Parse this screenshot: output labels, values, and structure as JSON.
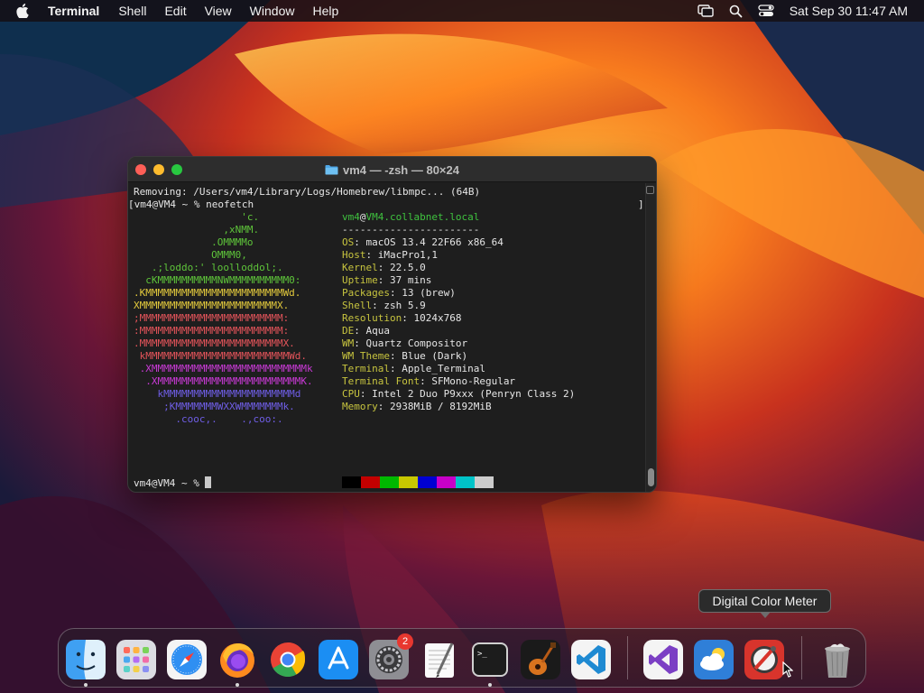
{
  "menubar": {
    "app_name": "Terminal",
    "menus": [
      "Shell",
      "Edit",
      "View",
      "Window",
      "Help"
    ],
    "clock": "Sat Sep 30  11:47 AM",
    "status_icons": [
      "screen-mirroring-icon",
      "spotlight-search-icon",
      "control-center-icon"
    ]
  },
  "terminal": {
    "title": "vm4 — -zsh — 80×24",
    "removing_line": "Removing: /Users/vm4/Library/Logs/Homebrew/libmpc... (64B)",
    "prompt_command": "[vm4@VM4 ~ % neofetch",
    "prompt_bracket_end": "]",
    "final_prompt": "vm4@VM4 ~ % ",
    "logo_lines": [
      "                  'c.",
      "               ,xNMM.",
      "             .OMMMMo",
      "             OMMM0,",
      "   .;loddo:' loolloddol;.",
      "  cKMMMMMMMMMMNWMMMMMMMMMM0:",
      ".KMMMMMMMMMMMMMMMMMMMMMMMWd.",
      "XMMMMMMMMMMMMMMMMMMMMMMMX.",
      ";MMMMMMMMMMMMMMMMMMMMMMMM:",
      ":MMMMMMMMMMMMMMMMMMMMMMMM:",
      ".MMMMMMMMMMMMMMMMMMMMMMMMX.",
      " kMMMMMMMMMMMMMMMMMMMMMMMMWd.",
      " .XMMMMMMMMMMMMMMMMMMMMMMMMMMk",
      "  .XMMMMMMMMMMMMMMMMMMMMMMMMK.",
      "    kMMMMMMMMMMMMMMMMMMMMMMd",
      "     ;KMMMMMMMWXXWMMMMMMMk.",
      "       .cooc,.    .,coo:."
    ],
    "userhost_user": "vm4",
    "userhost_at": "@",
    "userhost_host": "VM4.collabnet.local",
    "separator": "-----------------------",
    "info": [
      {
        "key": "OS",
        "value": "macOS 13.4 22F66 x86_64"
      },
      {
        "key": "Host",
        "value": "iMacPro1,1"
      },
      {
        "key": "Kernel",
        "value": "22.5.0"
      },
      {
        "key": "Uptime",
        "value": "37 mins"
      },
      {
        "key": "Packages",
        "value": "13 (brew)"
      },
      {
        "key": "Shell",
        "value": "zsh 5.9"
      },
      {
        "key": "Resolution",
        "value": "1024x768"
      },
      {
        "key": "DE",
        "value": "Aqua"
      },
      {
        "key": "WM",
        "value": "Quartz Compositor"
      },
      {
        "key": "WM Theme",
        "value": "Blue (Dark)"
      },
      {
        "key": "Terminal",
        "value": "Apple_Terminal"
      },
      {
        "key": "Terminal Font",
        "value": "SFMono-Regular"
      },
      {
        "key": "CPU",
        "value": "Intel 2 Duo P9xxx (Penryn Class 2)"
      },
      {
        "key": "Memory",
        "value": "2938MiB / 8192MiB"
      }
    ],
    "colors": {
      "key": "#c7c43f",
      "user": "#3fc23f",
      "logo": [
        "#5ec43a",
        "#5ec43a",
        "#5ec43a",
        "#5ec43a",
        "#5ec43a",
        "#5ec43a",
        "#e2c93c",
        "#e2c93c",
        "#e4545a",
        "#e4545a",
        "#e4545a",
        "#e4545a",
        "#c93ad6",
        "#c93ad6",
        "#6f5ee6",
        "#6f5ee6",
        "#6f5ee6"
      ],
      "palette_row1": [
        "#000000",
        "#c30000",
        "#00b800",
        "#c8c800",
        "#0000d2",
        "#c800c8",
        "#00c3c8",
        "#cccccc"
      ],
      "palette_row2": [
        "#6a6a6a",
        "#e00000",
        "#00d400",
        "#e8e800",
        "#0000ff",
        "#e800e8",
        "#00e8e8",
        "#e8e8e8"
      ]
    }
  },
  "tooltip": "Digital Color Meter",
  "dock": {
    "items": [
      "finder-icon",
      "launchpad-icon",
      "safari-icon",
      "firefox-icon",
      "chrome-icon",
      "app-store-icon",
      "system-settings-icon",
      "textedit-icon",
      "terminal-icon",
      "garageband-icon",
      "vscode-icon",
      "visual-studio-icon",
      "weather-icon",
      "digital-color-meter-icon",
      "trash-icon"
    ],
    "settings_badge": "2"
  }
}
